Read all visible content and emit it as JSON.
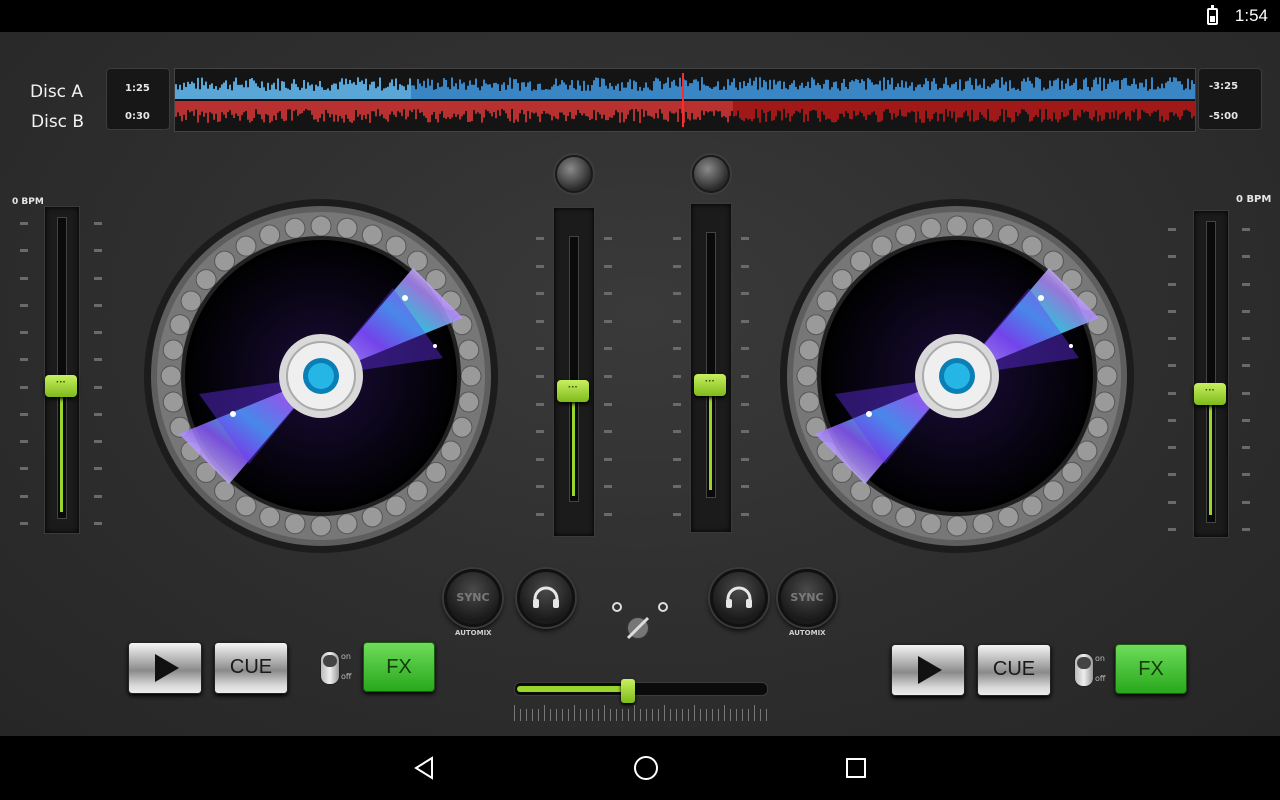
{
  "status_bar": {
    "time": "1:54",
    "battery_icon": "battery-charging-icon"
  },
  "header": {
    "disc_a_label": "Disc A",
    "disc_b_label": "Disc B",
    "disc_a_elapsed": "1:25",
    "disc_b_elapsed": "0:30",
    "disc_a_remaining": "-3:25",
    "disc_b_remaining": "-5:00",
    "disc_a_color": "#3a86c4",
    "disc_b_color": "#a01818"
  },
  "deck_left": {
    "bpm": "0 BPM",
    "pitch_level": 0.45,
    "play_icon": "play-icon",
    "cue_label": "CUE",
    "toggle_on": "on",
    "toggle_off": "off",
    "fx_label": "FX",
    "sync_label": "SYNC",
    "automix_label": "AUTOMIX",
    "headphone_icon": "headphones-icon"
  },
  "deck_right": {
    "bpm": "0 BPM",
    "pitch_level": 0.45,
    "play_icon": "play-icon",
    "cue_label": "CUE",
    "toggle_on": "on",
    "toggle_off": "off",
    "fx_label": "FX",
    "sync_label": "SYNC",
    "automix_label": "AUTOMIX",
    "headphone_icon": "headphones-icon"
  },
  "mixer": {
    "volume_a_level": 0.47,
    "volume_b_level": 0.47,
    "crossfader_level": 0.45,
    "accent_color": "#9ad62a"
  },
  "nav": {
    "back_icon": "back-icon",
    "home_icon": "home-icon",
    "recents_icon": "recents-icon"
  }
}
